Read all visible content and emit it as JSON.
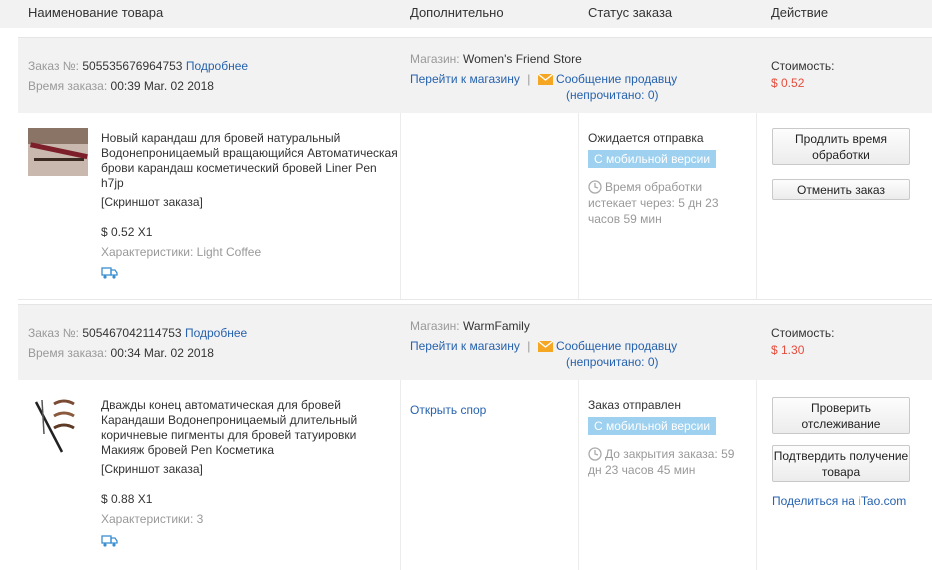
{
  "header": {
    "col_product": "Наименование товара",
    "col_extra": "Дополнительно",
    "col_status": "Статус заказа",
    "col_action": "Действие"
  },
  "common": {
    "order_no_label": "Заказ №:",
    "details_link": "Подробнее",
    "order_time_label": "Время заказа:",
    "store_label": "Магазин:",
    "go_to_store": "Перейти к магазину",
    "separator": "|",
    "message_seller": "Сообщение продавцу",
    "unread_prefix": "(непрочитано: ",
    "unread_suffix": ")",
    "cost_label": "Стоимость:",
    "screenshot": "[Скриншот заказа]",
    "characteristics_label": "Характеристики:",
    "mobile_badge": "С мобильной версии"
  },
  "orders": [
    {
      "order_no": "505535676964753",
      "order_time": "00:39 Mar. 02 2018",
      "store": "Women's Friend Store",
      "unread": "0",
      "cost": "$ 0.52",
      "product_title": "Новый карандаш для бровей натуральный Водонепроницаемый вращающийся Автоматическая брови карандаш косметический бровей Liner Pen h7jp",
      "unit_price": "$ 0.52 X1",
      "characteristics": "Light Coffee",
      "extra_action": "",
      "status": "Ожидается отправка",
      "timer_line1": "Время обработки",
      "timer_line2": "истекает через: 5 дн 23",
      "timer_line3": "часов 59 мин",
      "btn1": "Продлить время обработки",
      "btn2": "Отменить заказ"
    },
    {
      "order_no": "505467042114753",
      "order_time": "00:34 Mar. 02 2018",
      "store": "WarmFamily",
      "unread": "0",
      "cost": "$ 1.30",
      "product_title": "Дважды конец автоматическая для бровей Карандаши Водонепроницаемый длительный коричневые пигменты для бровей татуировки Макияж бровей Pen Косметика",
      "unit_price": "$ 0.88 X1",
      "characteristics": "3",
      "extra_action": "Открыть спор",
      "status": "Заказ отправлен",
      "timer_line1": "До закрытия заказа: 59",
      "timer_line2": "дн 23 часов 45 мин",
      "btn1": "Проверить отслеживание",
      "btn2": "Подтвердить получение товара",
      "share_prefix": "Поделиться на ",
      "share_brand_i": "i",
      "share_brand_rest": "Tao.com"
    }
  ],
  "colors": {
    "price": "#e64c3c",
    "link": "#2662ae",
    "badge": "#9ed0ef"
  }
}
